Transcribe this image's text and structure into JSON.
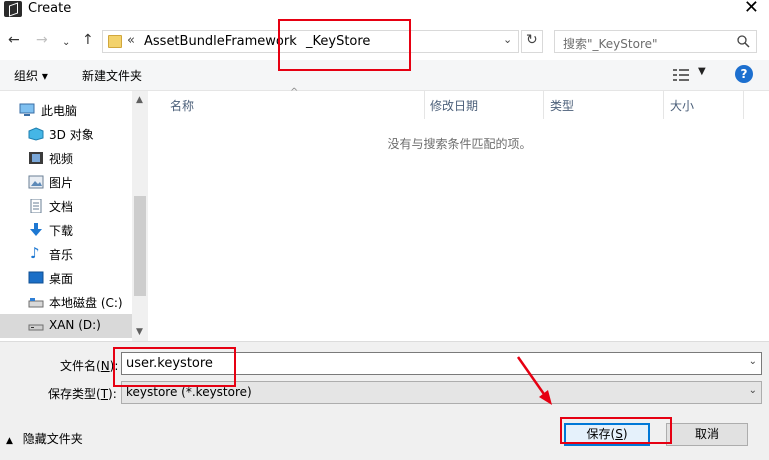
{
  "window": {
    "title": "Create",
    "close_icon": "close-icon"
  },
  "nav": {
    "back_icon": "arrow-left-icon",
    "forward_icon": "arrow-right-icon",
    "recent_icon": "chevron-down-icon",
    "up_icon": "arrow-up-icon"
  },
  "address": {
    "overflow": "«",
    "crumb1": "AssetBundleFramework",
    "sep": "›",
    "crumb2": "_KeyStore",
    "dropdown": "⌄",
    "refresh": "↻"
  },
  "search": {
    "placeholder": "搜索\"_KeyStore\""
  },
  "toolbar": {
    "organize": "组织 ▾",
    "new_folder": "新建文件夹",
    "help": "?"
  },
  "sidebar": {
    "items": [
      {
        "label": "此电脑",
        "icon": "computer-icon"
      },
      {
        "label": "3D 对象",
        "icon": "3d-objects-icon"
      },
      {
        "label": "视频",
        "icon": "video-icon"
      },
      {
        "label": "图片",
        "icon": "pictures-icon"
      },
      {
        "label": "文档",
        "icon": "documents-icon"
      },
      {
        "label": "下载",
        "icon": "download-icon"
      },
      {
        "label": "音乐",
        "icon": "music-icon"
      },
      {
        "label": "桌面",
        "icon": "desktop-icon"
      },
      {
        "label": "本地磁盘 (C:)",
        "icon": "drive-icon"
      },
      {
        "label": "XAN (D:)",
        "icon": "drive-icon"
      }
    ]
  },
  "list": {
    "columns": [
      "名称",
      "修改日期",
      "类型",
      "大小"
    ],
    "empty_message": "没有与搜索条件匹配的项。"
  },
  "form": {
    "filename_label": "文件名(",
    "filename_key": "N",
    "filename_suffix": "):",
    "filename_value": "user.keystore",
    "filetype_label": "保存类型(",
    "filetype_key": "T",
    "filetype_suffix": "):",
    "filetype_value": "keystore (*.keystore)",
    "hide_folders": "隐藏文件夹",
    "save_label": "保存(",
    "save_key": "S",
    "save_suffix": ")",
    "cancel": "取消"
  },
  "colors": {
    "annotation": "#e60012",
    "accent": "#0078d7",
    "selected": "#cce8ff"
  }
}
